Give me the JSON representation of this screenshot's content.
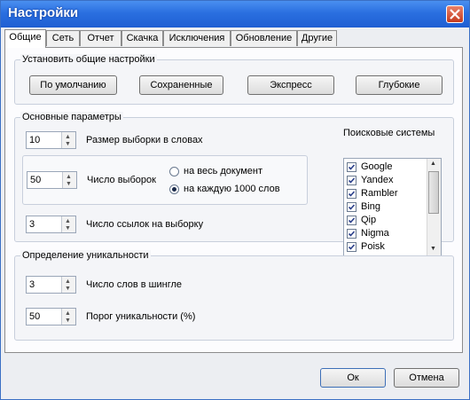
{
  "window": {
    "title": "Настройки"
  },
  "tabs": [
    "Общие",
    "Сеть",
    "Отчет",
    "Скачка",
    "Исключения",
    "Обновление",
    "Другие"
  ],
  "general": {
    "group_label": "Установить общие настройки",
    "buttons": [
      "По умолчанию",
      "Сохраненные",
      "Экспресс",
      "Глубокие"
    ]
  },
  "basic": {
    "group_label": "Основные параметры",
    "sample_size": {
      "value": "10",
      "label": "Размер выборки в словах"
    },
    "sample_count": {
      "value": "50",
      "label": "Число выборок"
    },
    "radio_whole": "на весь документ",
    "radio_per1000": "на каждую 1000 слов",
    "links_per_sample": {
      "value": "3",
      "label": "Число ссылок на выборку"
    },
    "search_label": "Поисковые системы",
    "engines": [
      {
        "name": "Google",
        "checked": true
      },
      {
        "name": "Yandex",
        "checked": true
      },
      {
        "name": "Rambler",
        "checked": true
      },
      {
        "name": "Bing",
        "checked": true
      },
      {
        "name": "Qip",
        "checked": true
      },
      {
        "name": "Nigma",
        "checked": true
      },
      {
        "name": "Poisk",
        "checked": true
      }
    ]
  },
  "uniqueness": {
    "group_label": "Определение уникальности",
    "shingle": {
      "value": "3",
      "label": "Число слов в шингле"
    },
    "threshold": {
      "value": "50",
      "label": "Порог уникальности (%)"
    }
  },
  "footer": {
    "ok": "Ок",
    "cancel": "Отмена"
  }
}
